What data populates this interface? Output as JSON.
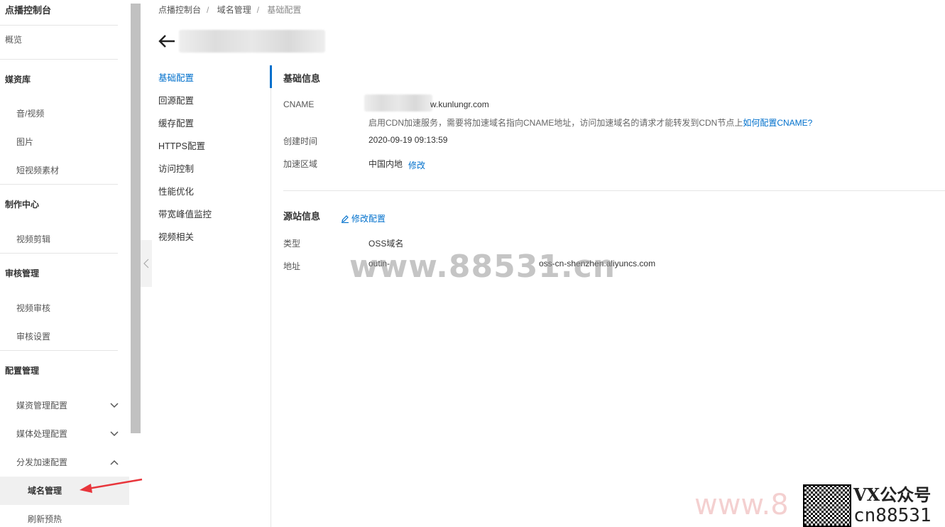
{
  "sidebar": {
    "title": "点播控制台",
    "overview": "概览",
    "sections": [
      {
        "title": "媒资库",
        "items": [
          "音/视频",
          "图片",
          "短视频素材"
        ]
      },
      {
        "title": "制作中心",
        "items": [
          "视频剪辑"
        ]
      },
      {
        "title": "审核管理",
        "items": [
          "视频审核",
          "审核设置"
        ]
      },
      {
        "title": "配置管理",
        "items": [
          "媒资管理配置",
          "媒体处理配置",
          "分发加速配置"
        ]
      }
    ],
    "sub_items": [
      "域名管理",
      "刷新预热"
    ]
  },
  "breadcrumb": [
    "点播控制台",
    "域名管理",
    "基础配置"
  ],
  "tabs": [
    "基础配置",
    "回源配置",
    "缓存配置",
    "HTTPS配置",
    "访问控制",
    "性能优化",
    "带宽峰值监控",
    "视频相关"
  ],
  "basic": {
    "title": "基础信息",
    "cname_label": "CNAME",
    "cname_value": "w.kunlungr.com",
    "cname_hint": "启用CDN加速服务，需要将加速域名指向CNAME地址，访问加速域名的请求才能转发到CDN节点上",
    "cname_link": "如何配置CNAME?",
    "created_label": "创建时间",
    "created_value": "2020-09-19 09:13:59",
    "region_label": "加速区域",
    "region_value": "中国内地",
    "region_edit": "修改"
  },
  "origin": {
    "title": "源站信息",
    "edit_label": "修改配置",
    "type_label": "类型",
    "type_value": "OSS域名",
    "addr_label": "地址",
    "addr_prefix": "outin-",
    "addr_suffix": "oss-cn-shenzhen.aliyuncs.com"
  },
  "watermark": {
    "center": "www.88531.cn",
    "bottom": "www.8",
    "wx_line1": "VX公众号",
    "wx_line2": "cn88531"
  },
  "colors": {
    "accent": "#0070cc",
    "arrow": "#e8353b"
  }
}
